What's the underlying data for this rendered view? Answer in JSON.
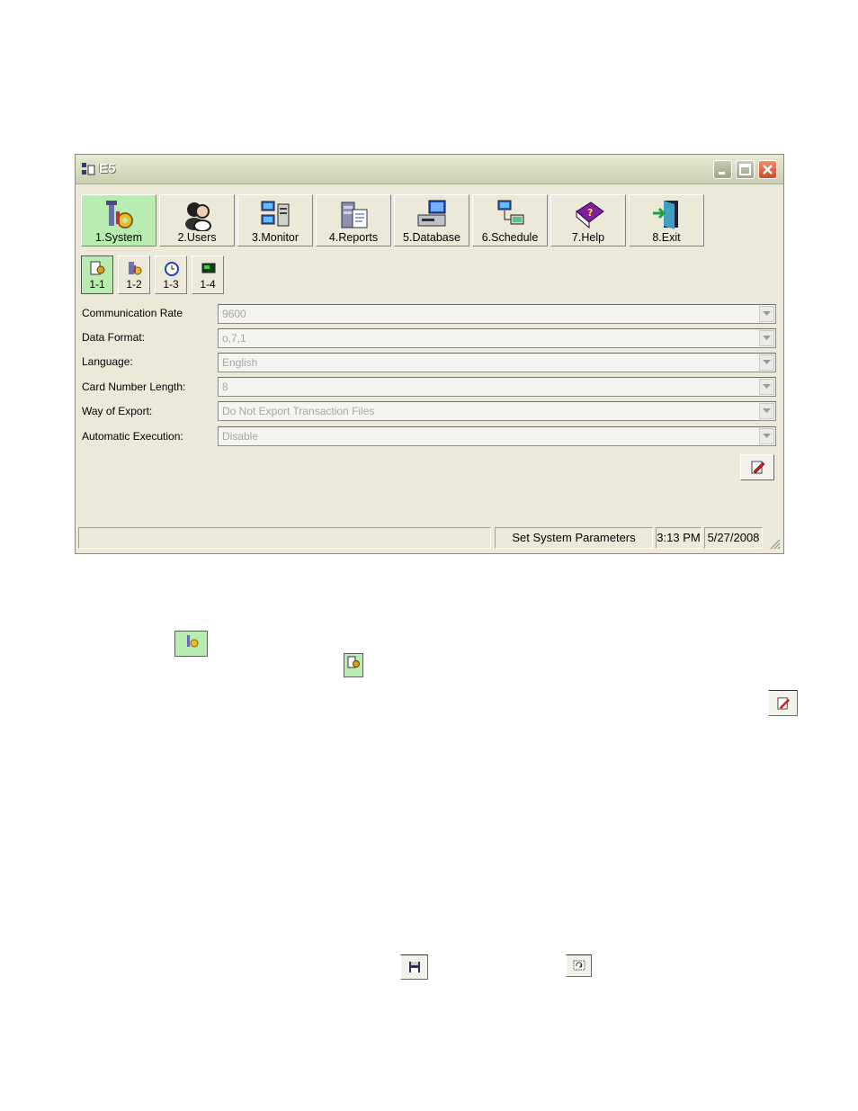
{
  "window": {
    "title": "E5",
    "controls": [
      "minimize-icon",
      "maximize-icon",
      "close-icon"
    ]
  },
  "toolbar": [
    {
      "label": "1.System",
      "icon": "system-tools-icon",
      "active": true
    },
    {
      "label": "2.Users",
      "icon": "users-icon",
      "active": false
    },
    {
      "label": "3.Monitor",
      "icon": "monitor-icon",
      "active": false
    },
    {
      "label": "4.Reports",
      "icon": "reports-icon",
      "active": false
    },
    {
      "label": "5.Database",
      "icon": "database-icon",
      "active": false
    },
    {
      "label": "6.Schedule",
      "icon": "schedule-icon",
      "active": false
    },
    {
      "label": "7.Help",
      "icon": "help-book-icon",
      "active": false
    },
    {
      "label": "8.Exit",
      "icon": "exit-door-icon",
      "active": false
    }
  ],
  "subtoolbar": [
    {
      "label": "1-1",
      "icon": "system-params-icon",
      "active": true
    },
    {
      "label": "1-2",
      "icon": "controller-icon",
      "active": false
    },
    {
      "label": "1-3",
      "icon": "clock-icon",
      "active": false
    },
    {
      "label": "1-4",
      "icon": "display-icon",
      "active": false
    }
  ],
  "params": [
    {
      "label": "Communication Rate",
      "value": "9600"
    },
    {
      "label": "Data Format:",
      "value": "o,7,1"
    },
    {
      "label": "Language:",
      "value": "English"
    },
    {
      "label": "Card Number Length:",
      "value": "8"
    },
    {
      "label": "Way of Export:",
      "value": "Do Not Export Transaction Files"
    },
    {
      "label": "Automatic Execution:",
      "value": "Disable"
    }
  ],
  "edit_button": {
    "icon": "edit-note-icon"
  },
  "statusbar": {
    "message": "",
    "mode": "Set System Parameters",
    "time": "3:13 PM",
    "date": "5/27/2008"
  },
  "below_window_icons": [
    "system-small-icon",
    "system-params-small-icon",
    "edit-small-icon",
    "save-icon",
    "restore-icon"
  ],
  "colors": {
    "active_button": "#b8ecb0",
    "window_bg": "#ece9d8",
    "close_button": "#cc4a2a"
  }
}
